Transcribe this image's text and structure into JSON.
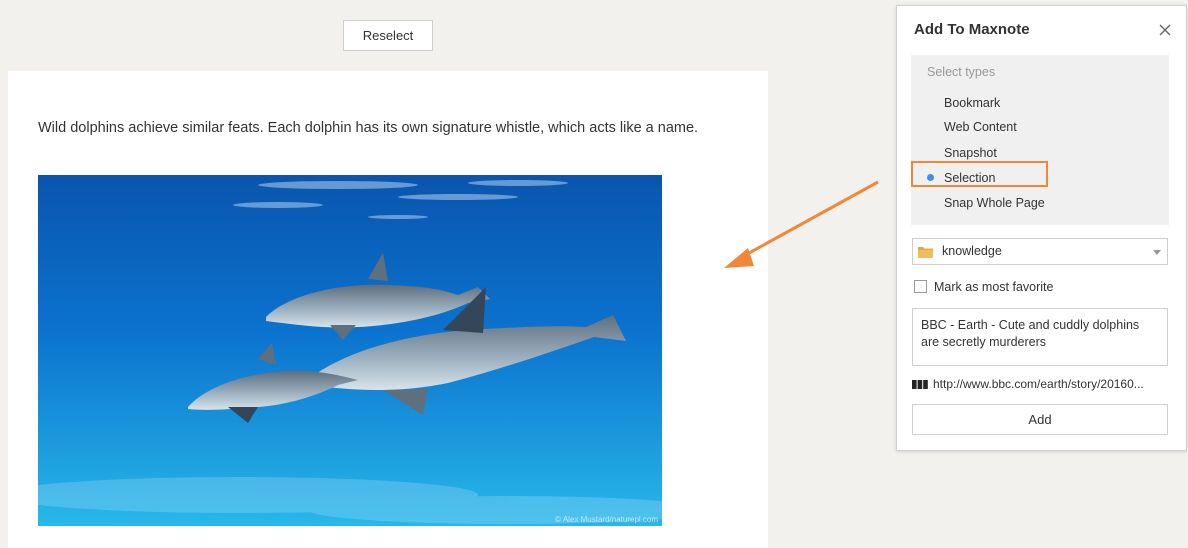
{
  "toolbar": {
    "reselect_label": "Reselect"
  },
  "article": {
    "text": "Wild dolphins achieve similar feats. Each dolphin has its own signature whistle, which acts like a name.",
    "photo_credit": "© Alex Mustard/naturepl.com"
  },
  "panel": {
    "title": "Add To Maxnote",
    "types_label": "Select types",
    "types": [
      {
        "label": "Bookmark",
        "selected": false
      },
      {
        "label": "Web Content",
        "selected": false
      },
      {
        "label": "Snapshot",
        "selected": false
      },
      {
        "label": "Selection",
        "selected": true
      },
      {
        "label": "Snap Whole Page",
        "selected": false
      }
    ],
    "folder": {
      "value": "knowledge",
      "icon": "folder-icon"
    },
    "favorite_label": "Mark as most favorite",
    "favorite_checked": false,
    "note_title": "BBC - Earth - Cute and cuddly dolphins are secretly murderers",
    "url": "http://www.bbc.com/earth/story/20160...",
    "add_label": "Add"
  },
  "colors": {
    "highlight": "#f0883a",
    "radio_dot": "#3d8ff0",
    "arrow": "#f0883a",
    "background": "#f2f1ee"
  }
}
